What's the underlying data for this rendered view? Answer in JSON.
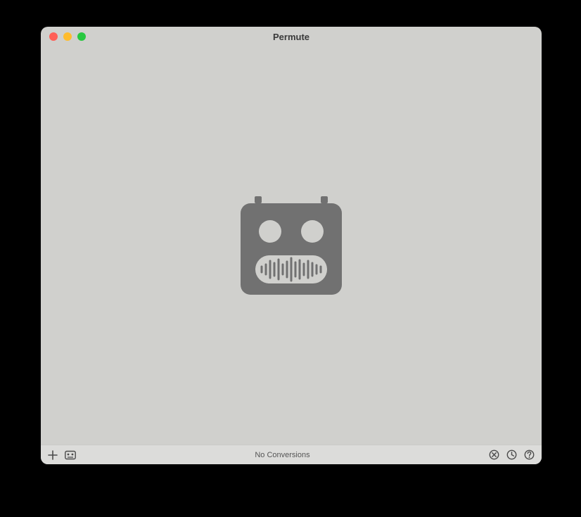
{
  "window": {
    "title": "Permute"
  },
  "bottomBar": {
    "status": "No Conversions"
  },
  "icons": {
    "logo": "robot-waveform-icon",
    "add": "plus-icon",
    "preset": "cassette-preset-icon",
    "cancel": "cancel-circle-icon",
    "history": "clock-icon",
    "help": "help-circle-icon"
  }
}
